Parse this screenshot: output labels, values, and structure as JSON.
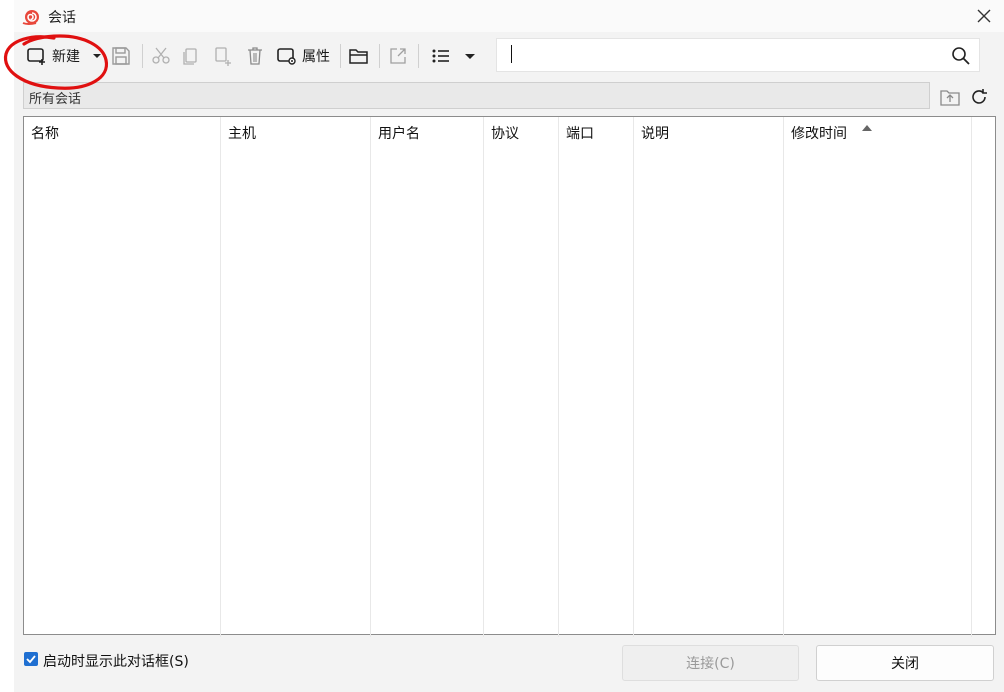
{
  "window": {
    "title": "会话",
    "app_icon": "snail-logo-icon",
    "close_icon": "close-icon"
  },
  "toolbar": {
    "new_label": "新建",
    "properties_label": "属性",
    "colors": {
      "enabled": "#1a1a1a",
      "disabled": "#b0b0b0"
    }
  },
  "search": {
    "value": "",
    "placeholder": ""
  },
  "path": {
    "current": "所有会话"
  },
  "table": {
    "columns": [
      "名称",
      "主机",
      "用户名",
      "协议",
      "端口",
      "说明",
      "修改时间"
    ],
    "sorted_column": "修改时间",
    "sort_direction": "ascending",
    "rows": []
  },
  "footer": {
    "startup_checkbox_label": "启动时显示此对话框(S)",
    "startup_checkbox_checked": true,
    "connect_label": "连接(C)",
    "close_label": "关闭"
  },
  "colors": {
    "accent": "#1f6fd1",
    "annotation": "#e01010"
  }
}
